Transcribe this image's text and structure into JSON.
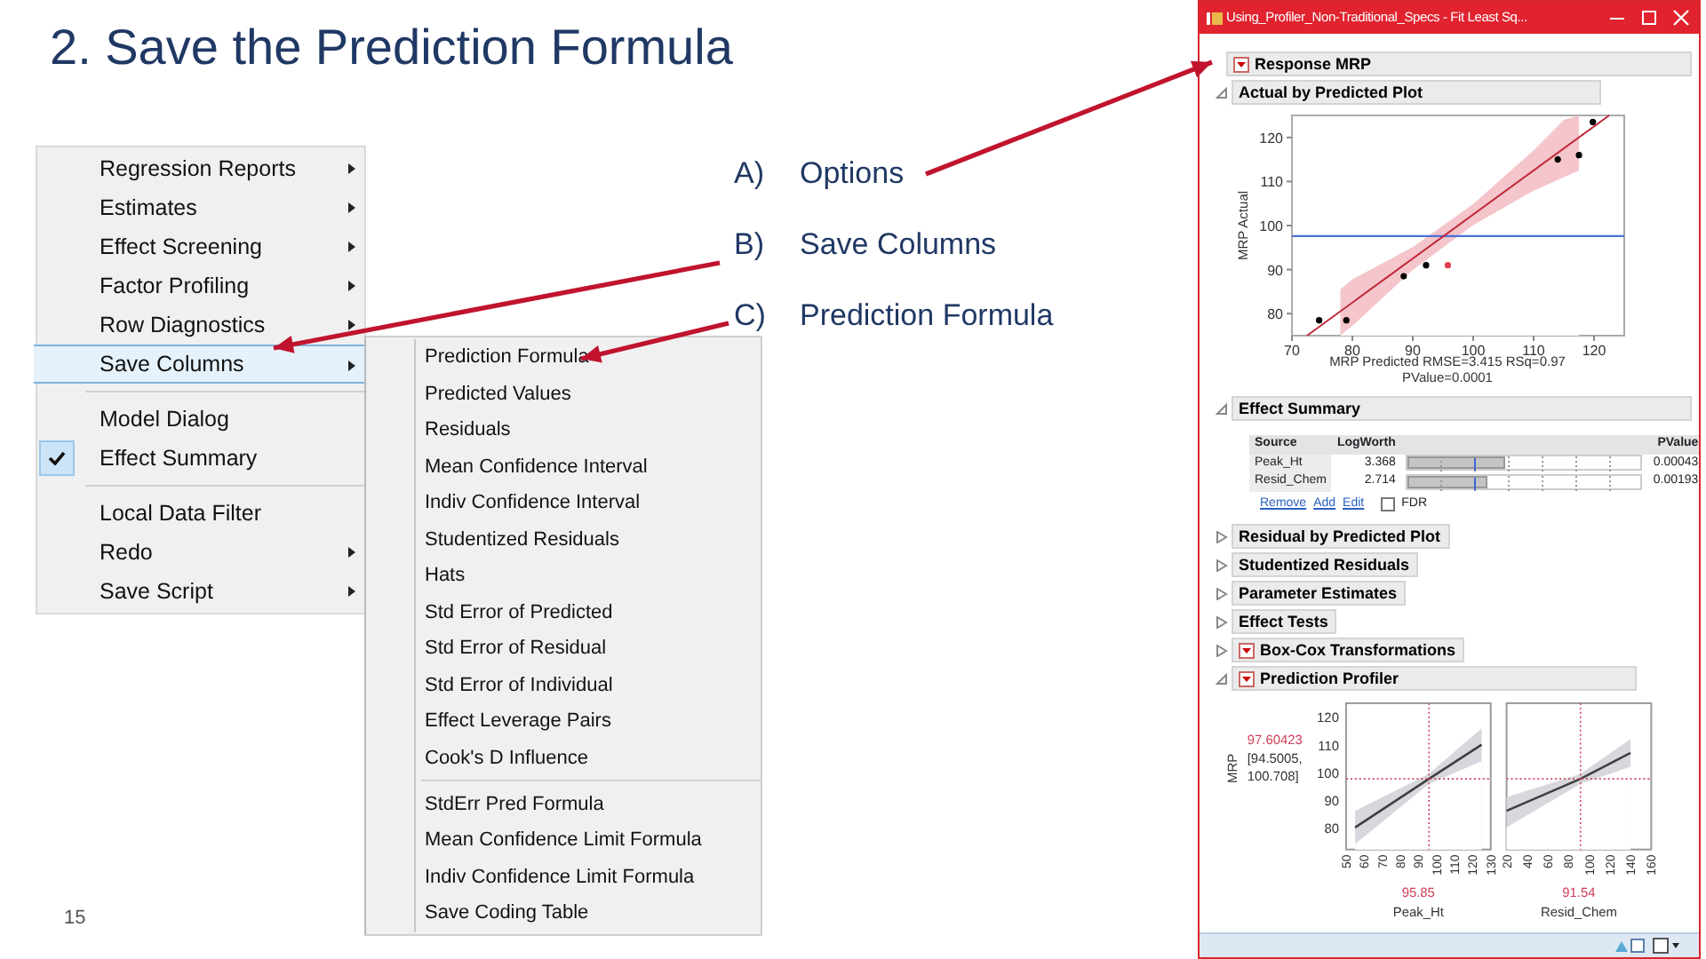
{
  "slide": {
    "title": "2. Save the Prediction Formula",
    "page_number": "15"
  },
  "steps": [
    {
      "marker": "A)",
      "text": "Options"
    },
    {
      "marker": "B)",
      "text": "Save Columns"
    },
    {
      "marker": "C)",
      "text": "Prediction Formula"
    }
  ],
  "menu": {
    "items": [
      {
        "kind": "item",
        "label": "Regression Reports",
        "submenu": true,
        "checked": false,
        "selected": false
      },
      {
        "kind": "item",
        "label": "Estimates",
        "submenu": true,
        "checked": false,
        "selected": false
      },
      {
        "kind": "item",
        "label": "Effect Screening",
        "submenu": true,
        "checked": false,
        "selected": false
      },
      {
        "kind": "item",
        "label": "Factor Profiling",
        "submenu": true,
        "checked": false,
        "selected": false
      },
      {
        "kind": "item",
        "label": "Row Diagnostics",
        "submenu": true,
        "checked": false,
        "selected": false
      },
      {
        "kind": "item",
        "label": "Save Columns",
        "submenu": true,
        "checked": false,
        "selected": true
      },
      {
        "kind": "separator"
      },
      {
        "kind": "item",
        "label": "Model Dialog",
        "submenu": false,
        "checked": false,
        "selected": false
      },
      {
        "kind": "item",
        "label": "Effect Summary",
        "submenu": false,
        "checked": true,
        "selected": false
      },
      {
        "kind": "separator"
      },
      {
        "kind": "item",
        "label": "Local Data Filter",
        "submenu": false,
        "checked": false,
        "selected": false
      },
      {
        "kind": "item",
        "label": "Redo",
        "submenu": true,
        "checked": false,
        "selected": false
      },
      {
        "kind": "item",
        "label": "Save Script",
        "submenu": true,
        "checked": false,
        "selected": false
      }
    ]
  },
  "submenu": {
    "items": [
      {
        "kind": "item",
        "label": "Prediction Formula"
      },
      {
        "kind": "item",
        "label": "Predicted Values"
      },
      {
        "kind": "item",
        "label": "Residuals"
      },
      {
        "kind": "item",
        "label": "Mean Confidence Interval"
      },
      {
        "kind": "item",
        "label": "Indiv Confidence Interval"
      },
      {
        "kind": "item",
        "label": "Studentized Residuals"
      },
      {
        "kind": "item",
        "label": "Hats"
      },
      {
        "kind": "item",
        "label": "Std Error of Predicted"
      },
      {
        "kind": "item",
        "label": "Std Error of Residual"
      },
      {
        "kind": "item",
        "label": "Std Error of Individual"
      },
      {
        "kind": "item",
        "label": "Effect Leverage Pairs"
      },
      {
        "kind": "item",
        "label": "Cook's D Influence"
      },
      {
        "kind": "separator"
      },
      {
        "kind": "item",
        "label": "StdErr Pred Formula"
      },
      {
        "kind": "item",
        "label": "Mean Confidence Limit Formula"
      },
      {
        "kind": "item",
        "label": "Indiv Confidence Limit Formula"
      },
      {
        "kind": "item",
        "label": "Save Coding Table"
      }
    ]
  },
  "window": {
    "title": "Using_Profiler_Non-Traditional_Specs - Fit Least Sq...",
    "response": {
      "title": "Response MRP",
      "has_menu": true
    },
    "actual_by_predicted": {
      "title": "Actual by Predicted Plot",
      "expanded": true,
      "chart_data": {
        "type": "scatter",
        "ylabel": "MRP Actual",
        "xlim": [
          70,
          125
        ],
        "ylim": [
          75,
          125
        ],
        "xticks": [
          70,
          80,
          90,
          100,
          110,
          120
        ],
        "yticks": [
          80,
          90,
          100,
          110,
          120
        ],
        "series": [
          {
            "type": "area",
            "color": "#f4c6cb",
            "x": [
              78,
              80,
              90,
              100,
              110,
              115,
              117.5
            ],
            "values": [
              85.5,
              87.8,
              95.1,
              104.9,
              117.1,
              124,
              125
            ]
          },
          {
            "type": "area",
            "color": "#ffffff",
            "x": [
              78,
              80,
              90,
              100,
              110,
              115,
              117.5
            ],
            "values": [
              75,
              77.2,
              89.9,
              100.1,
              107.9,
              111,
              112.5
            ]
          },
          {
            "color": "#000000",
            "x": [
              74.5,
              79,
              88.5,
              92.2,
              114,
              117.5,
              119.8
            ],
            "values": [
              78.5,
              78.5,
              88.5,
              91,
              115,
              116,
              123.5
            ]
          },
          {
            "color": "#e04050",
            "x": [
              95.8
            ],
            "values": [
              91
            ]
          },
          {
            "type": "line",
            "color": "#c0283a",
            "x": [
              72.5,
              122.5
            ],
            "values": [
              75,
              125
            ]
          }
        ],
        "ref_lines": [
          {
            "axis": "y",
            "value": 97.6,
            "color": "#4a6fd8"
          }
        ]
      },
      "caption": [
        "MRP Predicted RMSE=3.415 RSq=0.97",
        "PValue=0.0001"
      ]
    },
    "effect_summary": {
      "title": "Effect Summary",
      "expanded": true,
      "columns": [
        "Source",
        "LogWorth",
        "PValue"
      ],
      "rows": [
        {
          "source": "Peak_Ht",
          "logworth": "3.368",
          "level": 0.42,
          "pvalue": "0.00043"
        },
        {
          "source": "Resid_Chem",
          "logworth": "2.714",
          "level": 0.34,
          "pvalue": "0.00193"
        }
      ],
      "links": [
        "Remove",
        "Add",
        "Edit"
      ],
      "fdr": {
        "label": "FDR",
        "checked": false
      }
    },
    "collapsed_sections": [
      {
        "title": "Residual by Predicted Plot",
        "expanded": false,
        "has_menu": false
      },
      {
        "title": "Studentized Residuals",
        "expanded": false,
        "has_menu": false
      },
      {
        "title": "Parameter Estimates",
        "expanded": false,
        "has_menu": false
      },
      {
        "title": "Effect Tests",
        "expanded": false,
        "has_menu": false
      },
      {
        "title": "Box-Cox Transformations",
        "expanded": false,
        "has_menu": true
      }
    ],
    "profiler": {
      "title": "Prediction Profiler",
      "expanded": true,
      "has_menu": true,
      "ylabel": "MRP",
      "prediction": "97.60423",
      "interval": [
        "[94.5005,",
        "100.708]"
      ],
      "factors": [
        {
          "name": "Peak_Ht",
          "current": "95.85",
          "chart_data": {
            "type": "line",
            "xlim": [
              50,
              130
            ],
            "ylim": [
              72,
              125
            ],
            "xticks": [
              50,
              60,
              70,
              80,
              90,
              100,
              110,
              120,
              130
            ],
            "yticks": [
              80,
              90,
              100,
              110,
              120
            ],
            "x": [
              55,
              95.85,
              125
            ],
            "series": [
              {
                "type": "area",
                "color": "#d6d8de",
                "values": [
                  86,
                  99.4,
                  116
                ]
              },
              {
                "type": "area",
                "color": "#ffffff",
                "values": [
                  74,
                  95.8,
                  104
                ]
              },
              {
                "color": "#404040",
                "values": [
                  80,
                  97.6,
                  110
                ]
              }
            ],
            "ref_lines": [
              {
                "axis": "x",
                "value": 95.85,
                "color": "#d0405a"
              },
              {
                "axis": "y",
                "value": 97.6,
                "color": "#d0405a"
              }
            ]
          }
        },
        {
          "name": "Resid_Chem",
          "current": "91.54",
          "chart_data": {
            "type": "line",
            "xlim": [
              20,
              160
            ],
            "ylim": [
              72,
              125
            ],
            "xticks": [
              20,
              40,
              60,
              80,
              100,
              120,
              140,
              160
            ],
            "x": [
              20,
              91.54,
              140
            ],
            "series": [
              {
                "type": "area",
                "color": "#d6d8de",
                "values": [
                  91,
                  99.4,
                  112
                ]
              },
              {
                "type": "area",
                "color": "#ffffff",
                "values": [
                  80,
                  95.8,
                  102
                ]
              },
              {
                "color": "#404040",
                "values": [
                  86,
                  97.6,
                  107
                ]
              }
            ],
            "ref_lines": [
              {
                "axis": "x",
                "value": 91.54,
                "color": "#d0405a"
              },
              {
                "axis": "y",
                "value": 97.6,
                "color": "#d0405a"
              }
            ]
          }
        }
      ]
    }
  }
}
